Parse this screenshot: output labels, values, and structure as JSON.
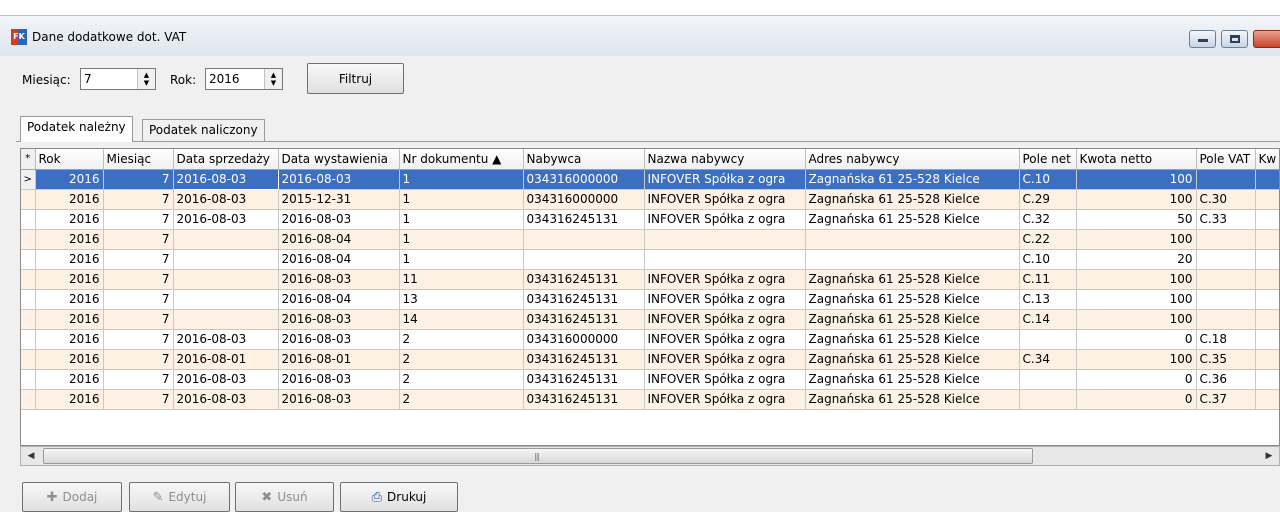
{
  "window": {
    "title": "Dane dodatkowe dot. VAT",
    "app_icon": "FK"
  },
  "filter": {
    "month_label": "Miesiąc:",
    "month_value": "7",
    "year_label": "Rok:",
    "year_value": "2016",
    "filter_button": "Filtruj"
  },
  "tabs": [
    {
      "label": "Podatek należny",
      "active": true
    },
    {
      "label": "Podatek naliczony",
      "active": false
    }
  ],
  "grid": {
    "columns": [
      "Rok",
      "Miesiąc",
      "Data sprzedaży",
      "Data wystawienia",
      "Nr dokumentu ▲",
      "Nabywca",
      "Nazwa nabywcy",
      "Adres nabywcy",
      "Pole net",
      "Kwota netto",
      "Pole VAT",
      "Kw"
    ],
    "rows": [
      [
        "2016",
        "7",
        "2016-08-03",
        "2016-08-03",
        "1",
        "034316000000",
        "INFOVER Spółka z ogra",
        "Zagnańska 61  25-528 Kielce",
        "C.10",
        "100",
        "",
        ""
      ],
      [
        "2016",
        "7",
        "2016-08-03",
        "2015-12-31",
        "1",
        "034316000000",
        "INFOVER Spółka z ogra",
        "Zagnańska 61  25-528 Kielce",
        "C.29",
        "100",
        "C.30",
        ""
      ],
      [
        "2016",
        "7",
        "2016-08-03",
        "2016-08-03",
        "1",
        "034316245131",
        "INFOVER Spółka z ogra",
        "Zagnańska 61  25-528 Kielce",
        "C.32",
        "50",
        "C.33",
        ""
      ],
      [
        "2016",
        "7",
        "",
        "2016-08-04",
        "1",
        "",
        "",
        "",
        "C.22",
        "100",
        "",
        ""
      ],
      [
        "2016",
        "7",
        "",
        "2016-08-04",
        "1",
        "",
        "",
        "",
        "C.10",
        "20",
        "",
        ""
      ],
      [
        "2016",
        "7",
        "",
        "2016-08-03",
        "11",
        "034316245131",
        "INFOVER Spółka z ogra",
        "Zagnańska 61  25-528 Kielce",
        "C.11",
        "100",
        "",
        ""
      ],
      [
        "2016",
        "7",
        "",
        "2016-08-04",
        "13",
        "034316245131",
        "INFOVER Spółka z ogra",
        "Zagnańska 61  25-528 Kielce",
        "C.13",
        "100",
        "",
        ""
      ],
      [
        "2016",
        "7",
        "",
        "2016-08-03",
        "14",
        "034316245131",
        "INFOVER Spółka z ogra",
        "Zagnańska 61  25-528 Kielce",
        "C.14",
        "100",
        "",
        ""
      ],
      [
        "2016",
        "7",
        "2016-08-03",
        "2016-08-03",
        "2",
        "034316000000",
        "INFOVER Spółka z ogra",
        "Zagnańska 61  25-528 Kielce",
        "",
        "0",
        "C.18",
        ""
      ],
      [
        "2016",
        "7",
        "2016-08-01",
        "2016-08-01",
        "2",
        "034316245131",
        "INFOVER Spółka z ogra",
        "Zagnańska 61  25-528 Kielce",
        "C.34",
        "100",
        "C.35",
        ""
      ],
      [
        "2016",
        "7",
        "2016-08-03",
        "2016-08-03",
        "2",
        "034316245131",
        "INFOVER Spółka z ogra",
        "Zagnańska 61  25-528 Kielce",
        "",
        "0",
        "C.36",
        ""
      ],
      [
        "2016",
        "7",
        "2016-08-03",
        "2016-08-03",
        "2",
        "034316245131",
        "INFOVER Spółka z ogra",
        "Zagnańska 61  25-528 Kielce",
        "",
        "0",
        "C.37",
        ""
      ]
    ],
    "selected_row": 0
  },
  "toolbar": {
    "add": "Dodaj",
    "edit": "Edytuj",
    "delete": "Usuń",
    "print": "Drukuj"
  },
  "colors": {
    "selection": "#3c6fc2",
    "alt_row": "#fdf1e3"
  }
}
